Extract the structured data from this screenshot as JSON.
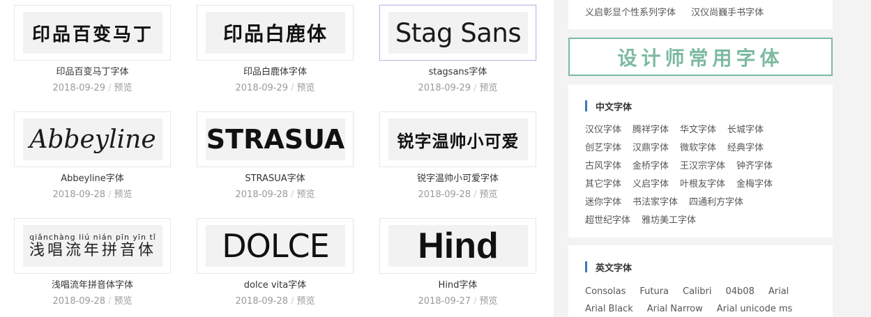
{
  "fonts": [
    {
      "name": "印品百变马丁字体",
      "date": "2018-09-29",
      "preview": "预览",
      "thumb": "印品百变马丁"
    },
    {
      "name": "印品白鹿体字体",
      "date": "2018-09-29",
      "preview": "预览",
      "thumb": "印品白鹿体"
    },
    {
      "name": "stagsans字体",
      "date": "2018-09-29",
      "preview": "预览",
      "thumb": "Stag Sans"
    },
    {
      "name": "Abbeyline字体",
      "date": "2018-09-28",
      "preview": "预览",
      "thumb": "Abbeyline"
    },
    {
      "name": "STRASUA字体",
      "date": "2018-09-28",
      "preview": "预览",
      "thumb": "STRASUA"
    },
    {
      "name": "锐字温帅小可爱字体",
      "date": "2018-09-28",
      "preview": "预览",
      "thumb": "锐字温帅小可爱"
    },
    {
      "name": "浅唱流年拼音体字体",
      "date": "2018-09-28",
      "preview": "预览",
      "thumb": "浅唱流年拼音体",
      "thumb_pinyin": "qiǎnchàng liú nián pīn yīn tǐ"
    },
    {
      "name": "dolce vita字体",
      "date": "2018-09-28",
      "preview": "预览",
      "thumb": "DOLCE"
    },
    {
      "name": "Hind字体",
      "date": "2018-09-27",
      "preview": "预览",
      "thumb": "Hind"
    }
  ],
  "meta_separator": "/",
  "sidebar": {
    "top_links": [
      "义启彰显个性系列字体",
      "汉仪尚巍手书字体"
    ],
    "banner_text": "设计师常用字体",
    "chinese": {
      "title": "中文字体",
      "rows": [
        [
          "汉仪字体",
          "腾祥字体",
          "华文字体",
          "长城字体"
        ],
        [
          "创艺字体",
          "汉鼎字体",
          "微软字体",
          "经典字体"
        ],
        [
          "古风字体",
          "金桥字体",
          "王汉宗字体",
          "钟齐字体"
        ],
        [
          "其它字体",
          "义启字体",
          "叶根友字体",
          "金梅字体"
        ],
        [
          "迷你字体",
          "书法家字体",
          "四通利方字体"
        ],
        [
          "超世纪字体",
          "雅坊美工字体"
        ]
      ]
    },
    "english": {
      "title": "英文字体",
      "rows": [
        [
          "Consolas",
          "Futura",
          "Calibri",
          "04b08",
          "Arial"
        ],
        [
          "Arial Black",
          "Arial Narrow",
          "Arial unicode ms"
        ]
      ]
    }
  },
  "colors": {
    "banner_green": "#7cbaa0",
    "title_bar_blue": "#3d78b8",
    "sidebar_bg": "#f3f3f3"
  }
}
